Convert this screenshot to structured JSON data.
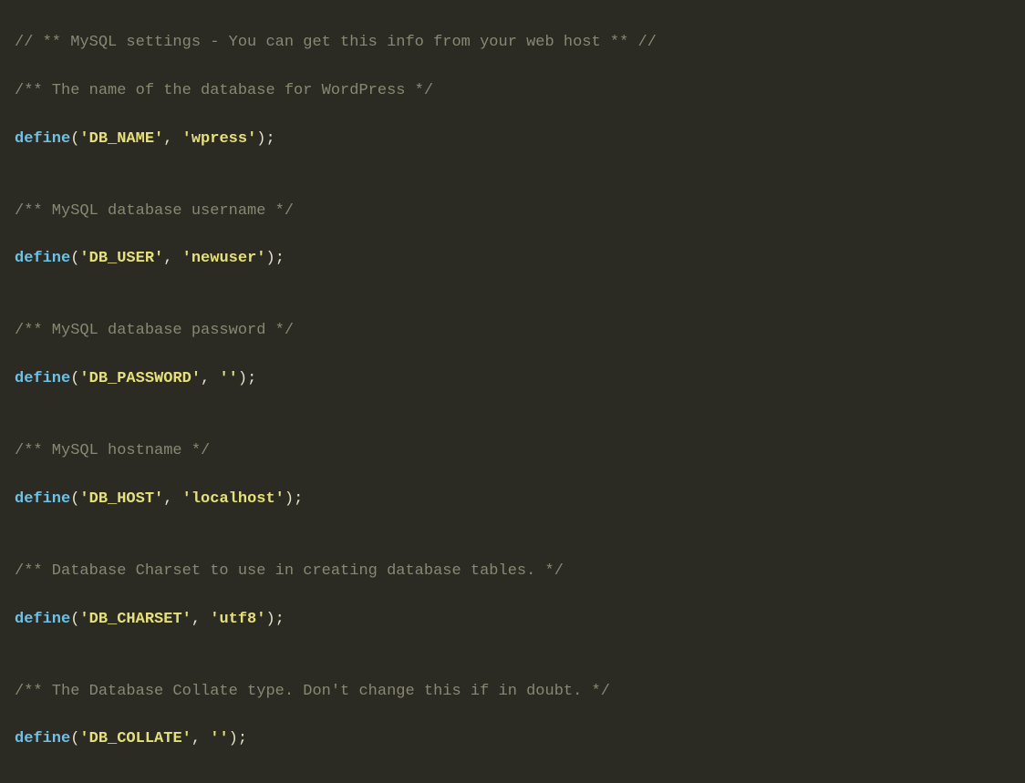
{
  "lines": {
    "l1": "// ** MySQL settings - You can get this info from your web host ** //",
    "l2": "/** The name of the database for WordPress */",
    "l3_kw": "define",
    "l3_p1": "(",
    "l3_arg1": "'DB_NAME'",
    "l3_comma": ", ",
    "l3_arg2": "'wpress'",
    "l3_p2": ")",
    "l3_semi": ";",
    "blank": "",
    "l4": "/** MySQL database username */",
    "l5_kw": "define",
    "l5_p1": "(",
    "l5_arg1": "'DB_USER'",
    "l5_comma": ", ",
    "l5_arg2": "'newuser'",
    "l5_p2": ")",
    "l5_semi": ";",
    "l6": "/** MySQL database password */",
    "l7_kw": "define",
    "l7_p1": "(",
    "l7_arg1": "'DB_PASSWORD'",
    "l7_comma": ", ",
    "l7_arg2": "''",
    "l7_p2": ")",
    "l7_semi": ";",
    "l8": "/** MySQL hostname */",
    "l9_kw": "define",
    "l9_p1": "(",
    "l9_arg1": "'DB_HOST'",
    "l9_comma": ", ",
    "l9_arg2": "'localhost'",
    "l9_p2": ")",
    "l9_semi": ";",
    "l10": "/** Database Charset to use in creating database tables. */",
    "l11_kw": "define",
    "l11_p1": "(",
    "l11_arg1": "'DB_CHARSET'",
    "l11_comma": ", ",
    "l11_arg2": "'utf8'",
    "l11_p2": ")",
    "l11_semi": ";",
    "l12": "/** The Database Collate type. Don't change this if in doubt. */",
    "l13_kw": "define",
    "l13_p1": "(",
    "l13_arg1": "'DB_COLLATE'",
    "l13_comma": ", ",
    "l13_arg2": "''",
    "l13_p2": ")",
    "l13_semi": ";"
  }
}
